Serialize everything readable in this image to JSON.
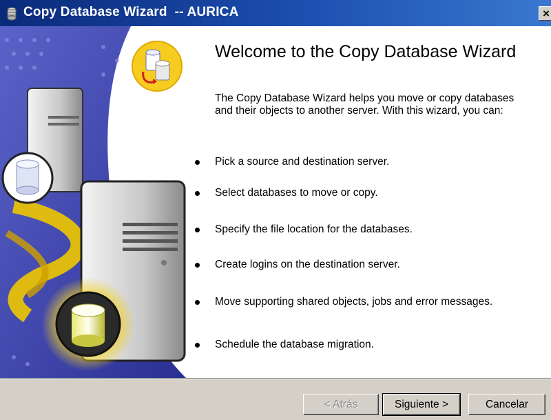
{
  "window": {
    "title": "Copy Database Wizard  -- AURICA",
    "close_label": "×"
  },
  "welcome": {
    "heading": "Welcome to the Copy Database Wizard",
    "intro": "The Copy Database Wizard helps you move or copy databases and their objects to another server. With this wizard, you can:",
    "bullets": [
      "Pick a source and destination server.",
      "Select databases to move or copy.",
      "Specify the file location for the databases.",
      "Create logins on the destination server.",
      "Move supporting shared objects, jobs and error messages.",
      "Schedule the database migration."
    ]
  },
  "buttons": {
    "back": "< Atrás",
    "next": "Siguiente >",
    "cancel": "Cancelar"
  },
  "colors": {
    "titlebar": "#0a2a7a",
    "banner_blue": "#3b3bb0",
    "highlight_yellow": "#f5c400",
    "dialog_face": "#d4d0c8"
  }
}
